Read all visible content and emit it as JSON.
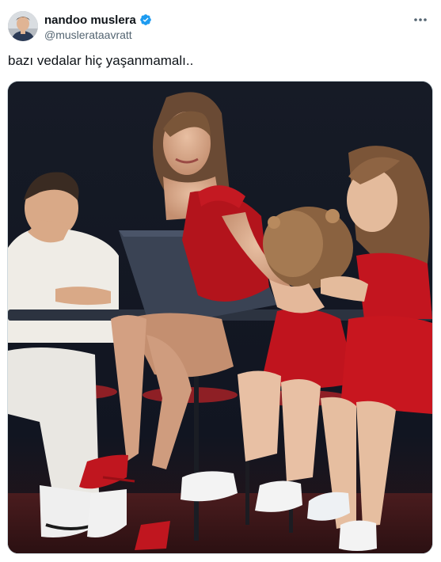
{
  "author": {
    "display_name": "nandoo muslera",
    "handle": "@muslerataavratt",
    "verified": true,
    "avatar_icon": "avatar-photo",
    "verified_color": "#1d9bf0"
  },
  "post": {
    "text": "bazı vedalar hiç yaşanmamalı..",
    "more_icon": "more-horizontal-icon"
  },
  "media": {
    "kind": "photo",
    "subject": "woman in red dress at a desk with three children"
  },
  "colors": {
    "text_primary": "#0f1419",
    "text_secondary": "#536471",
    "border": "#cfd9de",
    "accent": "#1d9bf0"
  }
}
